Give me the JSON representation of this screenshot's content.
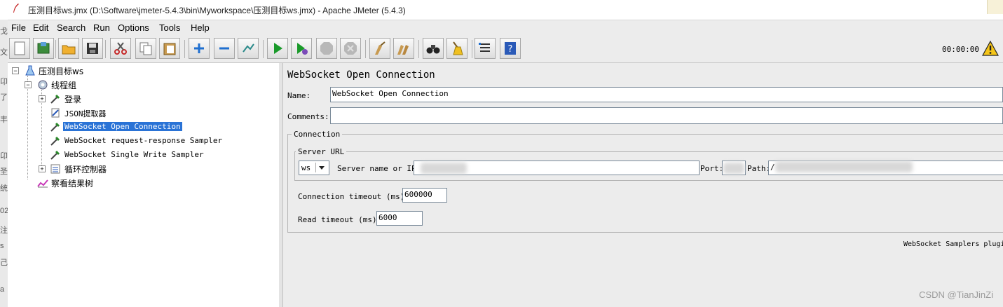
{
  "window": {
    "title": "压测目标ws.jmx (D:\\Software\\jmeter-5.4.3\\bin\\Myworkspace\\压测目标ws.jmx) - Apache JMeter (5.4.3)"
  },
  "menu": [
    "File",
    "Edit",
    "Search",
    "Run",
    "Options",
    "Tools",
    "Help"
  ],
  "toolbar": {
    "buttons": [
      "new-icon",
      "templates-icon",
      "open-icon",
      "save-icon",
      "cut-icon",
      "copy-icon",
      "paste-icon",
      "expand-icon",
      "collapse-icon",
      "toggle-icon",
      "start-icon",
      "start-no-pause-icon",
      "stop-icon",
      "shutdown-icon",
      "clear-icon",
      "clear-all-icon",
      "search-icon",
      "reset-search-icon",
      "function-helper-icon",
      "help-icon"
    ],
    "timer": "00:00:00",
    "warning_count": ""
  },
  "tree": {
    "items": [
      {
        "label": "压测目标ws"
      },
      {
        "label": "线程组"
      },
      {
        "label": "登录"
      },
      {
        "label": "JSON提取器"
      },
      {
        "label": "WebSocket Open Connection"
      },
      {
        "label": "WebSocket request-response Sampler"
      },
      {
        "label": "WebSocket Single Write Sampler"
      },
      {
        "label": "循环控制器"
      },
      {
        "label": "察看结果树"
      }
    ],
    "selected": "WebSocket Open Connection"
  },
  "panel": {
    "heading": "WebSocket Open Connection",
    "name_label": "Name:",
    "name_value": "WebSocket Open Connection",
    "comments_label": "Comments:",
    "comments_value": "",
    "connection_title": "Connection",
    "server_url_title": "Server URL",
    "protocol": "ws",
    "server_label": "Server name or IP:",
    "port_label": "Port:",
    "path_label": "Path:",
    "path_value": "/",
    "conn_timeout_label": "Connection timeout (ms):",
    "conn_timeout_value": "600000",
    "read_timeout_label": "Read timeout (ms):",
    "read_timeout_value": "6000",
    "footer": "WebSocket Samplers plugin. C"
  },
  "watermark": "CSDN @TianJinZi",
  "left_strip_chars": [
    "戈",
    "文",
    "卬",
    "了",
    "丰",
    "卬",
    "圣",
    "统",
    "02",
    "注",
    "s",
    "己",
    "a"
  ]
}
